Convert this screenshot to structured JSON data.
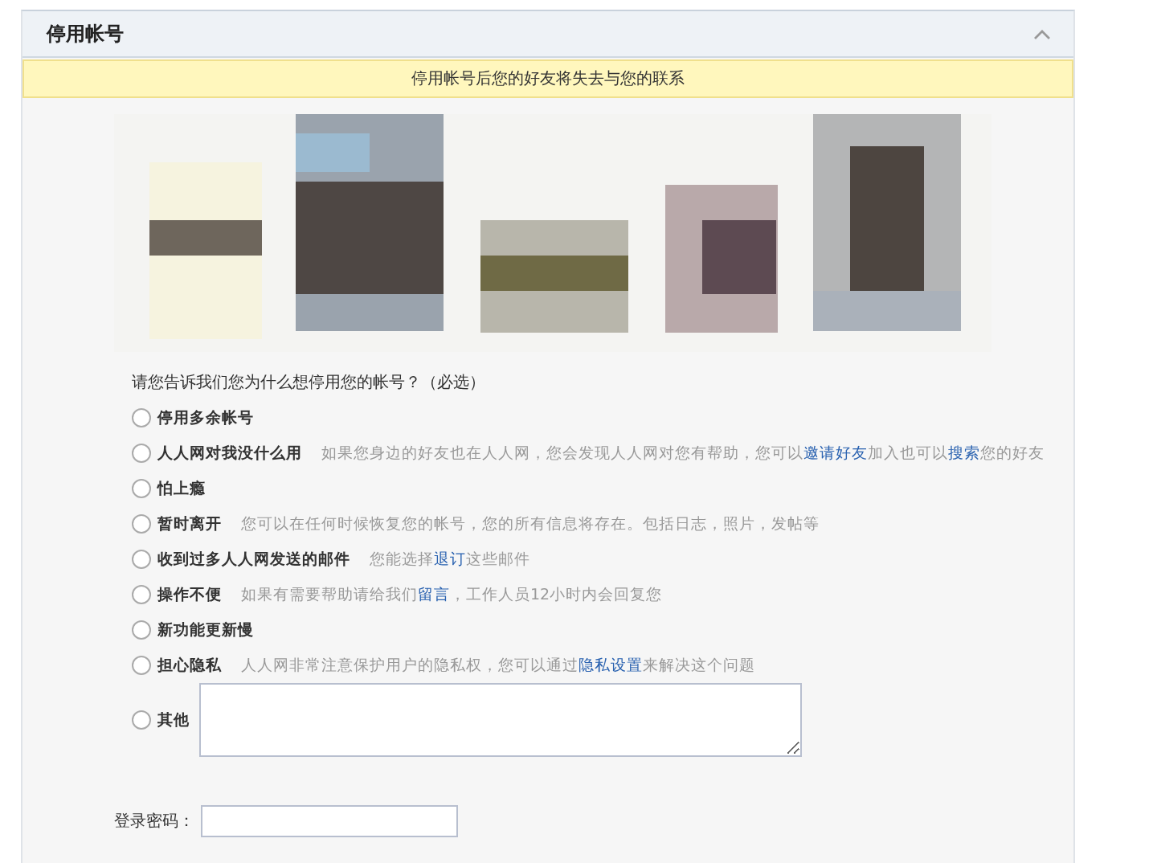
{
  "panel": {
    "title": "停用帐号",
    "expanded": true
  },
  "notice": "停用帐号后您的好友将失去与您的联系",
  "question": "请您告诉我们您为什么想停用您的帐号？（必选）",
  "reasons": [
    {
      "label": "停用多余帐号",
      "selected": false
    },
    {
      "label": "人人网对我没什么用",
      "selected": false,
      "hint": [
        {
          "kind": "text",
          "text": "如果您身边的好友也在人人网，您会发现人人网对您有帮助，您可以"
        },
        {
          "kind": "link",
          "text": "邀请好友"
        },
        {
          "kind": "text",
          "text": "加入也可以"
        },
        {
          "kind": "link",
          "text": "搜索"
        },
        {
          "kind": "text",
          "text": "您的好友"
        }
      ]
    },
    {
      "label": "怕上瘾",
      "selected": false
    },
    {
      "label": "暂时离开",
      "selected": false,
      "hint": [
        {
          "kind": "text",
          "text": "您可以在任何时候恢复您的帐号，您的所有信息将存在。包括日志，照片，发帖等"
        }
      ]
    },
    {
      "label": "收到过多人人网发送的邮件",
      "selected": false,
      "hint": [
        {
          "kind": "text",
          "text": "您能选择"
        },
        {
          "kind": "link",
          "text": "退订"
        },
        {
          "kind": "text",
          "text": "这些邮件"
        }
      ]
    },
    {
      "label": "操作不便",
      "selected": false,
      "hint": [
        {
          "kind": "text",
          "text": "如果有需要帮助请给我们"
        },
        {
          "kind": "link",
          "text": "留言"
        },
        {
          "kind": "text",
          "text": "，工作人员12小时内会回复您"
        }
      ]
    },
    {
      "label": "新功能更新慢",
      "selected": false
    },
    {
      "label": "担心隐私",
      "selected": false,
      "hint": [
        {
          "kind": "text",
          "text": "人人网非常注意保护用户的隐私权，您可以通过"
        },
        {
          "kind": "link",
          "text": "隐私设置"
        },
        {
          "kind": "text",
          "text": "来解决这个问题"
        }
      ]
    },
    {
      "label": "其他",
      "selected": false,
      "kind": "textarea"
    }
  ],
  "password": {
    "label": "登录密码："
  }
}
